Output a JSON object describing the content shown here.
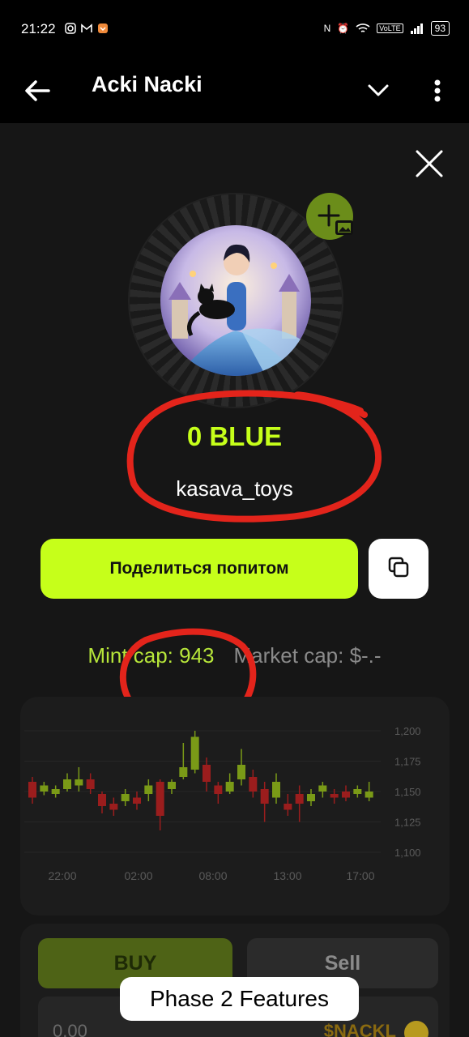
{
  "status_bar": {
    "time": "21:22",
    "battery": "93",
    "network_badge": "VoLTE"
  },
  "app_bar": {
    "title": "Acki Nacki"
  },
  "profile": {
    "token_name": "0 BLUE",
    "username": "kasava_toys"
  },
  "actions": {
    "share_label": "Поделиться попитом"
  },
  "stats": {
    "mint_cap": "Mint cap: 943",
    "market_cap": "Market cap: $-.-"
  },
  "chart_data": {
    "type": "candlestick",
    "y_ticks": [
      "1,200",
      "1,175",
      "1,150",
      "1,125",
      "1,100"
    ],
    "x_ticks": [
      "22:00",
      "02:00",
      "08:00",
      "13:00",
      "17:00"
    ],
    "ylim": [
      1100,
      1200
    ]
  },
  "trade": {
    "buy_label": "BUY",
    "sell_label": "Sell",
    "amount": "0.00",
    "currency": "$NACKL"
  },
  "toast": {
    "text": "Phase 2 Features"
  },
  "colors": {
    "accent": "#c6ff1a",
    "candle_up": "#7a9a17",
    "candle_down": "#9b1d1d",
    "annotation": "#e3241b"
  }
}
